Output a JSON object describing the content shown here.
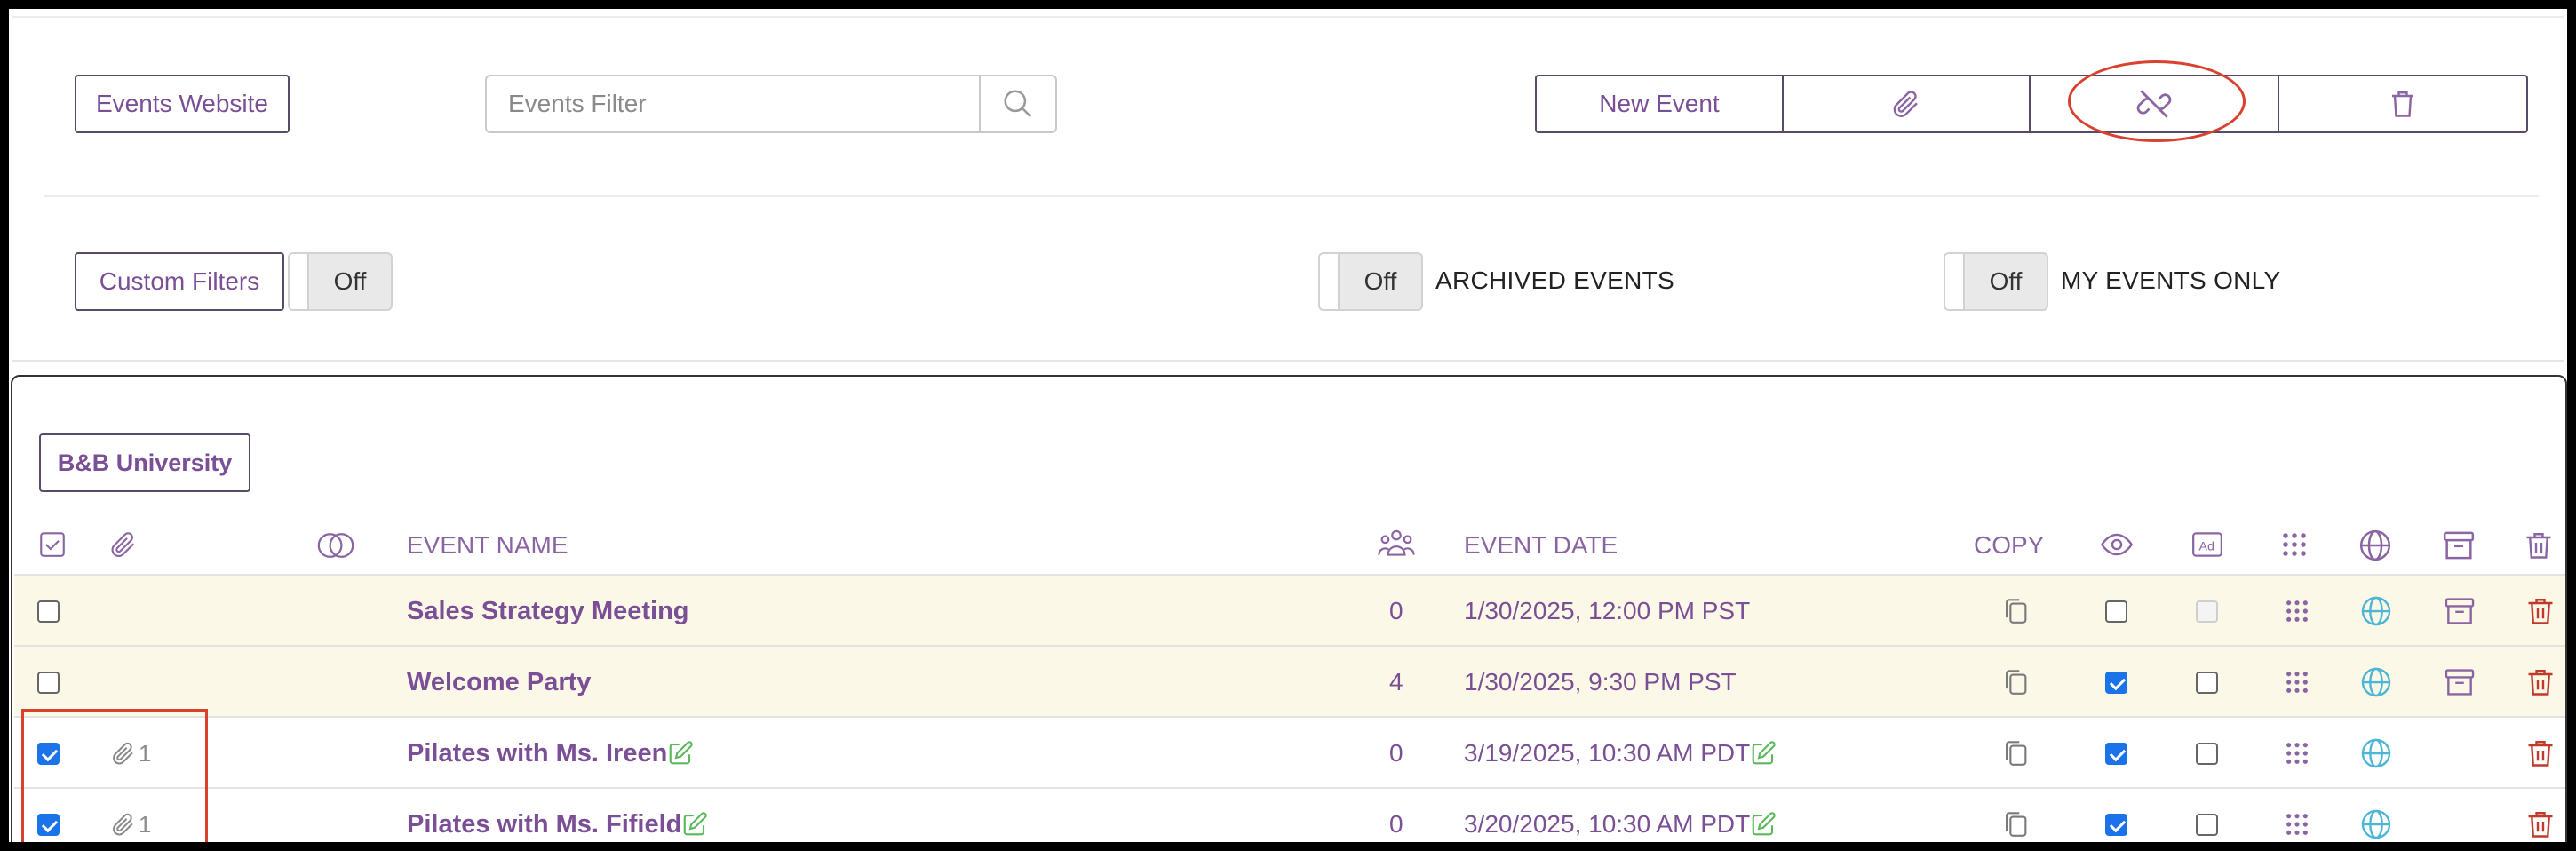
{
  "toolbar": {
    "events_website_label": "Events Website",
    "search_placeholder": "Events Filter",
    "new_event_label": "New Event",
    "attach_icon": "paperclip-icon",
    "detach_icon": "unlink-icon",
    "delete_icon": "trash-icon"
  },
  "filters": {
    "custom_filters_label": "Custom Filters",
    "custom_filters_toggle": "Off",
    "archived_toggle": "Off",
    "archived_label": "ARCHIVED EVENTS",
    "my_events_toggle": "Off",
    "my_events_label": "MY EVENTS ONLY"
  },
  "group": {
    "name": "B&B University"
  },
  "table": {
    "headers": {
      "event_name": "EVENT NAME",
      "event_date": "EVENT DATE",
      "copy": "COPY"
    },
    "rows": [
      {
        "selected": false,
        "attachments": "",
        "name": "Sales Strategy Meeting",
        "editable": false,
        "attendees": "0",
        "date": "1/30/2025, 12:00 PM PST",
        "visible": false,
        "ad": false,
        "ad_disabled": true,
        "archivable": true,
        "tinted": true
      },
      {
        "selected": false,
        "attachments": "",
        "name": "Welcome Party",
        "editable": false,
        "attendees": "4",
        "date": "1/30/2025, 9:30 PM PST",
        "visible": true,
        "ad": false,
        "ad_disabled": false,
        "archivable": true,
        "tinted": true
      },
      {
        "selected": true,
        "attachments": "1",
        "name": "Pilates with Ms. Ireen",
        "editable": true,
        "attendees": "0",
        "date": "3/19/2025, 10:30 AM PDT",
        "visible": true,
        "ad": false,
        "ad_disabled": false,
        "archivable": false,
        "tinted": false
      },
      {
        "selected": true,
        "attachments": "1",
        "name": "Pilates with Ms. Fifield",
        "editable": true,
        "attendees": "0",
        "date": "3/20/2025, 10:30 AM PDT",
        "visible": true,
        "ad": false,
        "ad_disabled": false,
        "archivable": false,
        "tinted": false
      }
    ]
  },
  "colors": {
    "accent": "#7b4f96",
    "edit_green": "#5cb85c",
    "globe_blue": "#4db6d6",
    "delete_red": "#c0392b",
    "annotation_red": "#d9412e"
  }
}
